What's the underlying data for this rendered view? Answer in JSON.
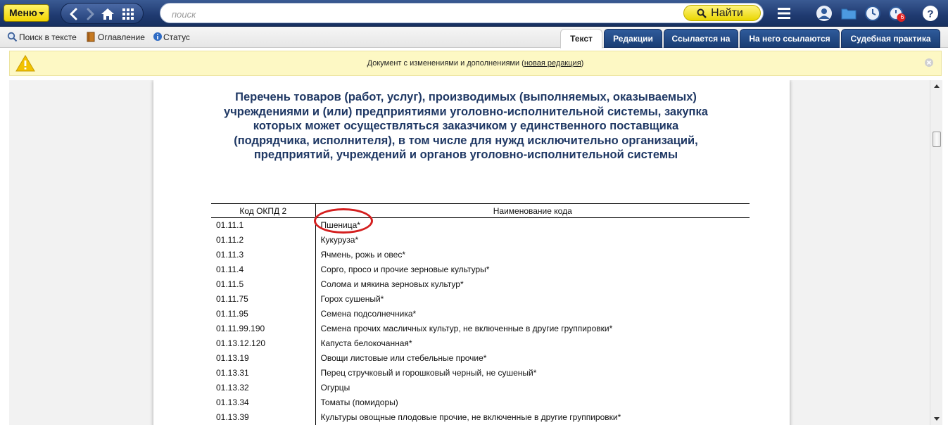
{
  "topbar": {
    "menu_label": "Меню",
    "search_placeholder": "поиск",
    "find_label": "Найти",
    "notification_count": "6"
  },
  "toolbar": {
    "search_in_text": "Поиск в тексте",
    "contents": "Оглавление",
    "status": "Статус"
  },
  "tabs": [
    {
      "label": "Текст",
      "active": true
    },
    {
      "label": "Редакции",
      "active": false
    },
    {
      "label": "Ссылается на",
      "active": false
    },
    {
      "label": "На него ссылаются",
      "active": false
    },
    {
      "label": "Судебная практика",
      "active": false
    }
  ],
  "notice": {
    "text_before": "Документ с изменениями и дополнениями (",
    "link": "новая редакция",
    "text_after": ")"
  },
  "document": {
    "title_lines": [
      "Перечень товаров (работ, услуг), производимых (выполняемых, оказываемых)",
      "учреждениями и (или) предприятиями уголовно-исполнительной системы, закупка",
      "которых может осуществляться заказчиком у единственного поставщика",
      "(подрядчика, исполнителя), в том числе для нужд исключительно организаций,",
      "предприятий, учреждений и органов уголовно-исполнительной системы"
    ],
    "table": {
      "headers": [
        "Код ОКПД 2",
        "Наименование кода"
      ],
      "rows": [
        {
          "code": "01.11.1",
          "name": "Пшеница*"
        },
        {
          "code": "01.11.2",
          "name": "Кукуруза*"
        },
        {
          "code": "01.11.3",
          "name": "Ячмень, рожь и овес*"
        },
        {
          "code": "01.11.4",
          "name": "Сорго, просо и прочие зерновые культуры*"
        },
        {
          "code": "01.11.5",
          "name": "Солома и мякина зерновых культур*"
        },
        {
          "code": "01.11.75",
          "name": "Горох сушеный*"
        },
        {
          "code": "01.11.95",
          "name": "Семена подсолнечника*"
        },
        {
          "code": "01.11.99.190",
          "name": "Семена прочих масличных культур, не включенные в другие группировки*"
        },
        {
          "code": "01.13.12.120",
          "name": "Капуста белокочанная*"
        },
        {
          "code": "01.13.19",
          "name": "Овощи листовые или стебельные прочие*"
        },
        {
          "code": "01.13.31",
          "name": "Перец стручковый и горошковый черный, не сушеный*"
        },
        {
          "code": "01.13.32",
          "name": "Огурцы"
        },
        {
          "code": "01.13.34",
          "name": "Томаты (помидоры)"
        },
        {
          "code": "01.13.39",
          "name": "Культуры овощные плодовые прочие, не включенные в другие группировки*"
        }
      ]
    }
  }
}
